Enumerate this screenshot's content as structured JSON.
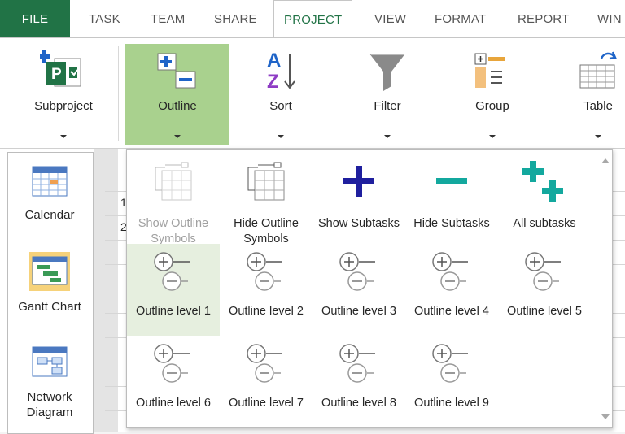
{
  "tabs": {
    "file": "FILE",
    "task": "TASK",
    "team": "TEAM",
    "share": "SHARE",
    "project": "PROJECT",
    "view": "VIEW",
    "format": "FORMAT",
    "report": "REPORT",
    "win": "WIN"
  },
  "ribbon": {
    "subproject": "Subproject",
    "outline": "Outline",
    "sort": "Sort",
    "filter": "Filter",
    "group": "Group",
    "table": "Table"
  },
  "views": {
    "calendar": "Calendar",
    "gantt": "Gantt Chart",
    "network_line1": "Network",
    "network_line2": "Diagram"
  },
  "grid": {
    "row1": "1",
    "row2": "2"
  },
  "menu": {
    "show_outline_1": "Show Outline",
    "show_outline_2": "Symbols",
    "hide_outline_1": "Hide Outline",
    "hide_outline_2": "Symbols",
    "show_subtasks": "Show Subtasks",
    "hide_subtasks": "Hide Subtasks",
    "all_subtasks": "All subtasks",
    "levels": [
      "Outline level 1",
      "Outline level 2",
      "Outline level 3",
      "Outline level 4",
      "Outline level 5",
      "Outline level 6",
      "Outline level 7",
      "Outline level 8",
      "Outline level 9"
    ]
  },
  "colors": {
    "accent": "#217346",
    "selected": "#a9d18e",
    "hover": "#e6efdf",
    "navy": "#1f1f9e",
    "teal": "#13a89e"
  }
}
